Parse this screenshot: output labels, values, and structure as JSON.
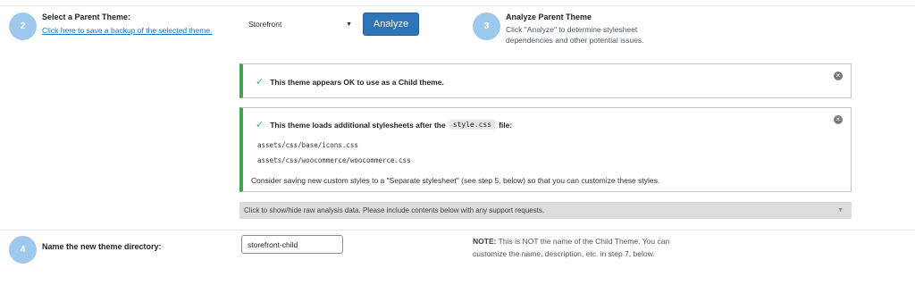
{
  "step2": {
    "number": "2",
    "title": "Select a Parent Theme:",
    "backup_link": "Click here to save a backup of the selected theme.",
    "selected_theme": "Storefront",
    "analyze_label": "Analyze"
  },
  "step3": {
    "number": "3",
    "title": "Analyze Parent Theme",
    "description_line1": "Click \"Analyze\" to determine stylesheet",
    "description_line2": "dependencies and other potential issues."
  },
  "notices": {
    "ok": {
      "message": "This theme appears OK to use as a Child theme."
    },
    "stylesheets": {
      "message_before": "This theme loads additional stylesheets after the",
      "file_name": "style.css",
      "message_after": "file:",
      "files": [
        "assets/css/base/icons.css",
        "assets/css/woocommerce/woocommerce.css"
      ],
      "advice": "Consider saving new custom styles to a \"Separate stylesheet\" (see step 5, below) so that you can customize these styles."
    }
  },
  "raw_toggle": {
    "label": "Click to show/hide raw analysis data. Please include contents below with any support requests."
  },
  "step4": {
    "number": "4",
    "title": "Name the new theme directory:",
    "directory_value": "storefront-child",
    "note_label": "NOTE:",
    "note_line1": "This is NOT the name of the Child Theme. You can",
    "note_line2": "customize the name, description, etc. in step 7, below."
  },
  "colors": {
    "accent": "#2e75b8",
    "step_circle": "#9fc8ee",
    "success": "#46a34b",
    "link": "#2271b1"
  },
  "icons": {
    "check": "checkmark-icon",
    "dismiss": "dismiss-icon",
    "caret": "chevron-down-icon"
  }
}
